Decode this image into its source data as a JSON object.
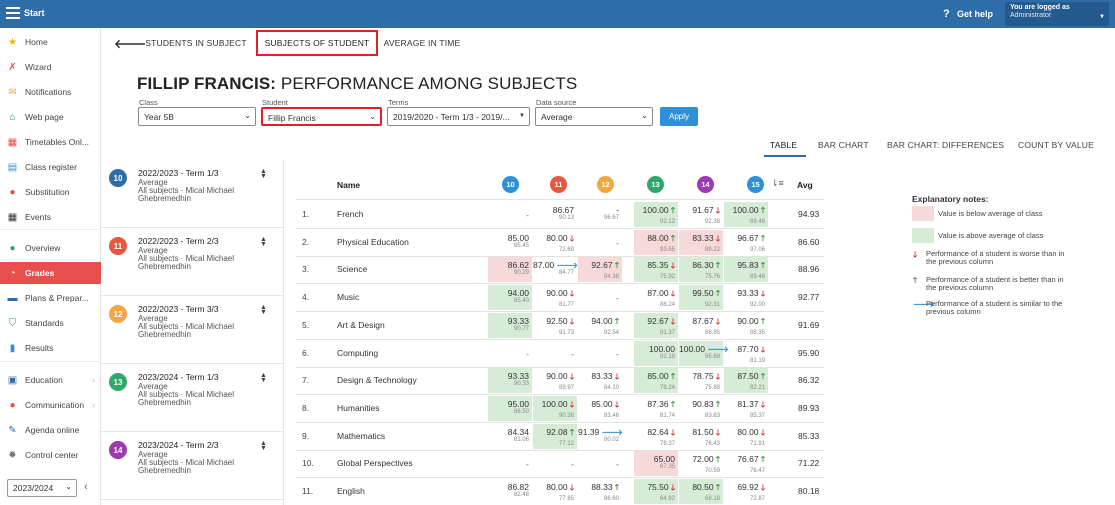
{
  "topbar": {
    "start": "Start",
    "help_icon": "?",
    "help": "Get help",
    "login_line1": "You are logged as",
    "login_line2": "Administrator"
  },
  "sidebar": {
    "items": [
      {
        "label": "Home",
        "icon": "star-icon",
        "glyph": "★",
        "color": "#f4b400"
      },
      {
        "label": "Wizard",
        "icon": "wand-icon",
        "glyph": "✗",
        "color": "#e84e4b"
      },
      {
        "label": "Notifications",
        "icon": "envelope-icon",
        "glyph": "✉",
        "color": "#f4a640"
      },
      {
        "label": "Web page",
        "icon": "house-icon",
        "glyph": "⌂",
        "color": "#1a8a5b"
      },
      {
        "label": "Timetables Onl...",
        "icon": "calendar-icon",
        "glyph": "▦",
        "color": "#e84e4b"
      },
      {
        "label": "Class register",
        "icon": "book-icon",
        "glyph": "▤",
        "color": "#2f90d9"
      },
      {
        "label": "Substitution",
        "icon": "person-icon",
        "glyph": "●",
        "color": "#e84e4b"
      },
      {
        "label": "Events",
        "icon": "events-icon",
        "glyph": "▦",
        "color": "#333333"
      },
      {
        "label": "Overview",
        "icon": "check-circle-icon",
        "glyph": "●",
        "color": "#2ea86b"
      },
      {
        "label": "Grades",
        "icon": "grades-icon",
        "glyph": "◔",
        "color": "#ffffff"
      },
      {
        "label": "Plans & Prepar...",
        "icon": "plans-icon",
        "glyph": "▬",
        "color": "#2f6da8"
      },
      {
        "label": "Standards",
        "icon": "shield-icon",
        "glyph": "⛉",
        "color": "#2ea86b"
      },
      {
        "label": "Results",
        "icon": "bar-chart-icon",
        "glyph": "▮",
        "color": "#2f90d9"
      },
      {
        "label": "Education",
        "icon": "briefcase-icon",
        "glyph": "▣",
        "color": "#2f6da8"
      },
      {
        "label": "Communication",
        "icon": "chat-icon",
        "glyph": "●",
        "color": "#e84e4b"
      },
      {
        "label": "Agenda online",
        "icon": "pen-icon",
        "glyph": "✎",
        "color": "#2f6da8"
      },
      {
        "label": "Control center",
        "icon": "gear-icon",
        "glyph": "✹",
        "color": "#777777"
      }
    ],
    "year": "2023/2024"
  },
  "tabs": {
    "students_in_subject": "STUDENTS IN SUBJECT",
    "subjects_of_student": "SUBJECTS OF STUDENT",
    "average_in_time": "AVERAGE IN TIME"
  },
  "title": {
    "student": "FILLIP FRANCIS:",
    "rest": " PERFORMANCE AMONG SUBJECTS"
  },
  "filters": {
    "class_label": "Class",
    "class_value": "Year 5B",
    "student_label": "Student",
    "student_value": "Fillip Francis",
    "terms_label": "Terms",
    "terms_value": "2019/2020 - Term 1/3 - 2019/...",
    "source_label": "Data source",
    "source_value": "Average",
    "apply": "Apply"
  },
  "views": {
    "table": "TABLE",
    "bar_chart": "BAR CHART",
    "bar_diff": "BAR CHART: DIFFERENCES",
    "count": "COUNT BY VALUE"
  },
  "terms": [
    {
      "num": "10",
      "color": "#2f6da8",
      "name": "2022/2023 - Term 1/3",
      "source": "Average",
      "scope": "All subjects · Mical Michael",
      "teacher": "Ghebremedhin"
    },
    {
      "num": "11",
      "color": "#e8573f",
      "name": "2022/2023 - Term 2/3",
      "source": "Average",
      "scope": "All subjects · Mical Michael",
      "teacher": "Ghebremedhin"
    },
    {
      "num": "12",
      "color": "#f4a640",
      "name": "2022/2023 - Term 3/3",
      "source": "Average",
      "scope": "All subjects · Mical Michael",
      "teacher": "Ghebremedhin"
    },
    {
      "num": "13",
      "color": "#2ea86b",
      "name": "2023/2024 - Term 1/3",
      "source": "Average",
      "scope": "All subjects · Mical Michael",
      "teacher": "Ghebremedhin"
    },
    {
      "num": "14",
      "color": "#9c3ab0",
      "name": "2023/2024 - Term 2/3",
      "source": "Average",
      "scope": "All subjects · Mical Michael",
      "teacher": "Ghebremedhin"
    }
  ],
  "table": {
    "name_header": "Name",
    "avg_header": "Avg",
    "columns": [
      {
        "num": "10",
        "color": "#2f90d9"
      },
      {
        "num": "11",
        "color": "#e8573f"
      },
      {
        "num": "12",
        "color": "#f4a640"
      },
      {
        "num": "13",
        "color": "#2ea86b"
      },
      {
        "num": "14",
        "color": "#9c3ab0"
      },
      {
        "num": "15",
        "color": "#2f90d9"
      }
    ],
    "rows": [
      {
        "num": "1.",
        "name": "French",
        "avg": "94.93",
        "cells": [
          {
            "v": "-",
            "c": "",
            "a": "",
            "s": ""
          },
          {
            "v": "86.67",
            "c": "90.13",
            "a": "",
            "s": ""
          },
          {
            "v": "-",
            "c": "96.67",
            "a": "",
            "s": ""
          },
          {
            "v": "100.00",
            "c": "92.12",
            "a": "up",
            "s": "above"
          },
          {
            "v": "91.67",
            "c": "92.38",
            "a": "down",
            "s": ""
          },
          {
            "v": "100.00",
            "c": "89.46",
            "a": "up",
            "s": "above"
          }
        ]
      },
      {
        "num": "2.",
        "name": "Physical Education",
        "avg": "86.60",
        "cells": [
          {
            "v": "85.00",
            "c": "85.45",
            "a": "",
            "s": ""
          },
          {
            "v": "80.00",
            "c": "72.69",
            "a": "down",
            "s": ""
          },
          {
            "v": "-",
            "c": "",
            "a": "",
            "s": ""
          },
          {
            "v": "88.00",
            "c": "93.65",
            "a": "up",
            "s": "below"
          },
          {
            "v": "83.33",
            "c": "89.22",
            "a": "down",
            "s": "below"
          },
          {
            "v": "96.67",
            "c": "97.06",
            "a": "up",
            "s": ""
          }
        ]
      },
      {
        "num": "3.",
        "name": "Science",
        "avg": "88.96",
        "cells": [
          {
            "v": "86.62",
            "c": "90.29",
            "a": "",
            "s": "below"
          },
          {
            "v": "87.00",
            "c": "84.77",
            "a": "same",
            "s": ""
          },
          {
            "v": "92.67",
            "c": "94.38",
            "a": "up",
            "s": "below"
          },
          {
            "v": "85.35",
            "c": "75.92",
            "a": "down",
            "s": "above"
          },
          {
            "v": "86.30",
            "c": "75.76",
            "a": "up",
            "s": "above"
          },
          {
            "v": "95.83",
            "c": "89.46",
            "a": "up",
            "s": "above"
          }
        ]
      },
      {
        "num": "4.",
        "name": "Music",
        "avg": "92.77",
        "cells": [
          {
            "v": "94.00",
            "c": "85.40",
            "a": "",
            "s": "above"
          },
          {
            "v": "90.00",
            "c": "81.77",
            "a": "down",
            "s": ""
          },
          {
            "v": "-",
            "c": "",
            "a": "",
            "s": ""
          },
          {
            "v": "87.00",
            "c": "88.24",
            "a": "down",
            "s": ""
          },
          {
            "v": "99.50",
            "c": "92.31",
            "a": "up",
            "s": "above"
          },
          {
            "v": "93.33",
            "c": "92.00",
            "a": "down",
            "s": ""
          }
        ]
      },
      {
        "num": "5.",
        "name": "Art & Design",
        "avg": "91.69",
        "cells": [
          {
            "v": "93.33",
            "c": "90.77",
            "a": "",
            "s": "above"
          },
          {
            "v": "92.50",
            "c": "91.73",
            "a": "down",
            "s": ""
          },
          {
            "v": "94.00",
            "c": "92.54",
            "a": "up",
            "s": ""
          },
          {
            "v": "92.67",
            "c": "91.37",
            "a": "down",
            "s": "above"
          },
          {
            "v": "87.67",
            "c": "88.85",
            "a": "down",
            "s": ""
          },
          {
            "v": "90.00",
            "c": "88.35",
            "a": "up",
            "s": ""
          }
        ]
      },
      {
        "num": "6.",
        "name": "Computing",
        "avg": "95.90",
        "cells": [
          {
            "v": "-",
            "c": "",
            "a": "",
            "s": ""
          },
          {
            "v": "-",
            "c": "",
            "a": "",
            "s": ""
          },
          {
            "v": "-",
            "c": "",
            "a": "",
            "s": ""
          },
          {
            "v": "100.00",
            "c": "92.19",
            "a": "",
            "s": "above"
          },
          {
            "v": "100.00",
            "c": "95.69",
            "a": "same",
            "s": "above"
          },
          {
            "v": "87.70",
            "c": "81.19",
            "a": "down",
            "s": ""
          }
        ]
      },
      {
        "num": "7.",
        "name": "Design & Technology",
        "avg": "86.32",
        "cells": [
          {
            "v": "93.33",
            "c": "90.33",
            "a": "",
            "s": "above"
          },
          {
            "v": "90.00",
            "c": "89.97",
            "a": "down",
            "s": ""
          },
          {
            "v": "83.33",
            "c": "84.10",
            "a": "down",
            "s": ""
          },
          {
            "v": "85.00",
            "c": "78.24",
            "a": "up",
            "s": "above"
          },
          {
            "v": "78.75",
            "c": "75.88",
            "a": "down",
            "s": ""
          },
          {
            "v": "87.50",
            "c": "82.21",
            "a": "up",
            "s": "above"
          }
        ]
      },
      {
        "num": "8.",
        "name": "Humanities",
        "avg": "89.93",
        "cells": [
          {
            "v": "95.00",
            "c": "86.50",
            "a": "",
            "s": "above"
          },
          {
            "v": "100.00",
            "c": "90.38",
            "a": "down",
            "s": "above"
          },
          {
            "v": "85.00",
            "c": "83.46",
            "a": "down",
            "s": ""
          },
          {
            "v": "87.36",
            "c": "81.74",
            "a": "up",
            "s": ""
          },
          {
            "v": "90.83",
            "c": "83.63",
            "a": "up",
            "s": ""
          },
          {
            "v": "81.37",
            "c": "85.37",
            "a": "down",
            "s": ""
          }
        ]
      },
      {
        "num": "9.",
        "name": "Mathematics",
        "avg": "85.33",
        "cells": [
          {
            "v": "84.34",
            "c": "81.06",
            "a": "",
            "s": ""
          },
          {
            "v": "92.08",
            "c": "77.12",
            "a": "up",
            "s": "above"
          },
          {
            "v": "91.39",
            "c": "80.02",
            "a": "same",
            "s": ""
          },
          {
            "v": "82.64",
            "c": "78.37",
            "a": "down",
            "s": ""
          },
          {
            "v": "81.50",
            "c": "76.43",
            "a": "down",
            "s": ""
          },
          {
            "v": "80.00",
            "c": "71.91",
            "a": "down",
            "s": ""
          }
        ]
      },
      {
        "num": "10.",
        "name": "Global Perspectives",
        "avg": "71.22",
        "cells": [
          {
            "v": "-",
            "c": "",
            "a": "",
            "s": ""
          },
          {
            "v": "-",
            "c": "",
            "a": "",
            "s": ""
          },
          {
            "v": "-",
            "c": "",
            "a": "",
            "s": ""
          },
          {
            "v": "65.00",
            "c": "67.35",
            "a": "",
            "s": "below"
          },
          {
            "v": "72.00",
            "c": "70.59",
            "a": "up",
            "s": ""
          },
          {
            "v": "76.67",
            "c": "76.47",
            "a": "up",
            "s": ""
          }
        ]
      },
      {
        "num": "11.",
        "name": "English",
        "avg": "80.18",
        "cells": [
          {
            "v": "86.82",
            "c": "82.48",
            "a": "",
            "s": ""
          },
          {
            "v": "80.00",
            "c": "77.65",
            "a": "down",
            "s": ""
          },
          {
            "v": "88.33",
            "c": "86.60",
            "a": "up",
            "s": ""
          },
          {
            "v": "75.50",
            "c": "64.92",
            "a": "down",
            "s": "above"
          },
          {
            "v": "80.50",
            "c": "68.18",
            "a": "up",
            "s": "above"
          },
          {
            "v": "69.92",
            "c": "72.87",
            "a": "down",
            "s": ""
          }
        ]
      }
    ]
  },
  "legend": {
    "title": "Explanatory notes:",
    "below": "Value is below average of class",
    "above": "Value is above average of class",
    "worse": "Performance of a student is worse than in the previous column",
    "better": "Performance of a student is better than in the previous column",
    "similar": "Performance of a student is similar to the previous column",
    "colors": {
      "below": "#f8d9d9",
      "above": "#d7ecd6",
      "up": "#2e8b35",
      "down": "#d9272e",
      "same": "#2f90d9"
    }
  }
}
